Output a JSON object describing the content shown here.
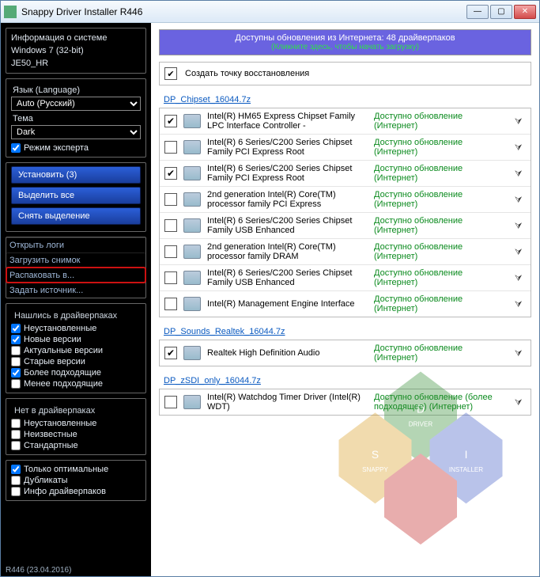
{
  "window": {
    "title": "Snappy Driver Installer R446"
  },
  "sidebar": {
    "sysinfo": {
      "head": "Информация о системе",
      "os": "Windows 7 (32-bit)",
      "host": "JE50_HR"
    },
    "lang_label": "Язык (Language)",
    "lang_value": "Auto (Русский)",
    "theme_label": "Тема",
    "theme_value": "Dark",
    "expert": "Режим эксперта",
    "actions": {
      "install": "Установить (3)",
      "select_all": "Выделить все",
      "deselect": "Снять выделение"
    },
    "links": {
      "open_logs": "Открыть логи",
      "load_snapshot": "Загрузить снимок",
      "extract": "Распаковать в...",
      "set_source": "Задать источник..."
    },
    "found_head": "Нашлись в драйверпаках",
    "found": [
      {
        "label": "Неустановленные",
        "checked": true
      },
      {
        "label": "Новые версии",
        "checked": true
      },
      {
        "label": "Актуальные версии",
        "checked": false
      },
      {
        "label": "Старые версии",
        "checked": false
      },
      {
        "label": "Более подходящие",
        "checked": true
      },
      {
        "label": "Менее подходящие",
        "checked": false
      }
    ],
    "missing_head": "Нет в драйверпаках",
    "missing": [
      {
        "label": "Неустановленные",
        "checked": false
      },
      {
        "label": "Неизвестные",
        "checked": false
      },
      {
        "label": "Стандартные",
        "checked": false
      }
    ],
    "tail": [
      {
        "label": "Только оптимальные",
        "checked": true
      },
      {
        "label": "Дубликаты",
        "checked": false
      },
      {
        "label": "Инфо драйверпаков",
        "checked": false
      }
    ],
    "footer": "R446 (23.04.2016)"
  },
  "main": {
    "banner": {
      "line1": "Доступны обновления из Интернета: 48 драйверпаков",
      "line2": "(Кликните здесь, чтобы начать загрузку)"
    },
    "restore": "Создать точку восстановления",
    "groups": [
      {
        "name": "DP_Chipset_16044.7z",
        "items": [
          {
            "checked": true,
            "name": "Intel(R) HM65 Express Chipset Family LPC Interface Controller -",
            "status": "Доступно обновление (Интернет)"
          },
          {
            "checked": false,
            "name": "Intel(R) 6 Series/C200 Series Chipset Family PCI Express Root",
            "status": "Доступно обновление (Интернет)"
          },
          {
            "checked": true,
            "name": "Intel(R) 6 Series/C200 Series Chipset Family PCI Express Root",
            "status": "Доступно обновление (Интернет)"
          },
          {
            "checked": false,
            "name": "2nd generation Intel(R) Core(TM) processor family PCI Express",
            "status": "Доступно обновление (Интернет)"
          },
          {
            "checked": false,
            "name": "Intel(R) 6 Series/C200 Series Chipset Family USB Enhanced",
            "status": "Доступно обновление (Интернет)"
          },
          {
            "checked": false,
            "name": "2nd generation Intel(R) Core(TM) processor family DRAM",
            "status": "Доступно обновление (Интернет)"
          },
          {
            "checked": false,
            "name": "Intel(R) 6 Series/C200 Series Chipset Family USB Enhanced",
            "status": "Доступно обновление (Интернет)"
          },
          {
            "checked": false,
            "name": "Intel(R) Management Engine Interface",
            "status": "Доступно обновление (Интернет)"
          }
        ]
      },
      {
        "name": "DP_Sounds_Realtek_16044.7z",
        "items": [
          {
            "checked": true,
            "name": "Realtek High Definition Audio",
            "status": "Доступно обновление (Интернет)"
          }
        ]
      },
      {
        "name": "DP_zSDI_only_16044.7z",
        "items": [
          {
            "checked": false,
            "name": "Intel(R) Watchdog Timer Driver (Intel(R) WDT)",
            "status": "Доступно обновление (более подходящее) (Интернет)"
          }
        ]
      }
    ]
  }
}
